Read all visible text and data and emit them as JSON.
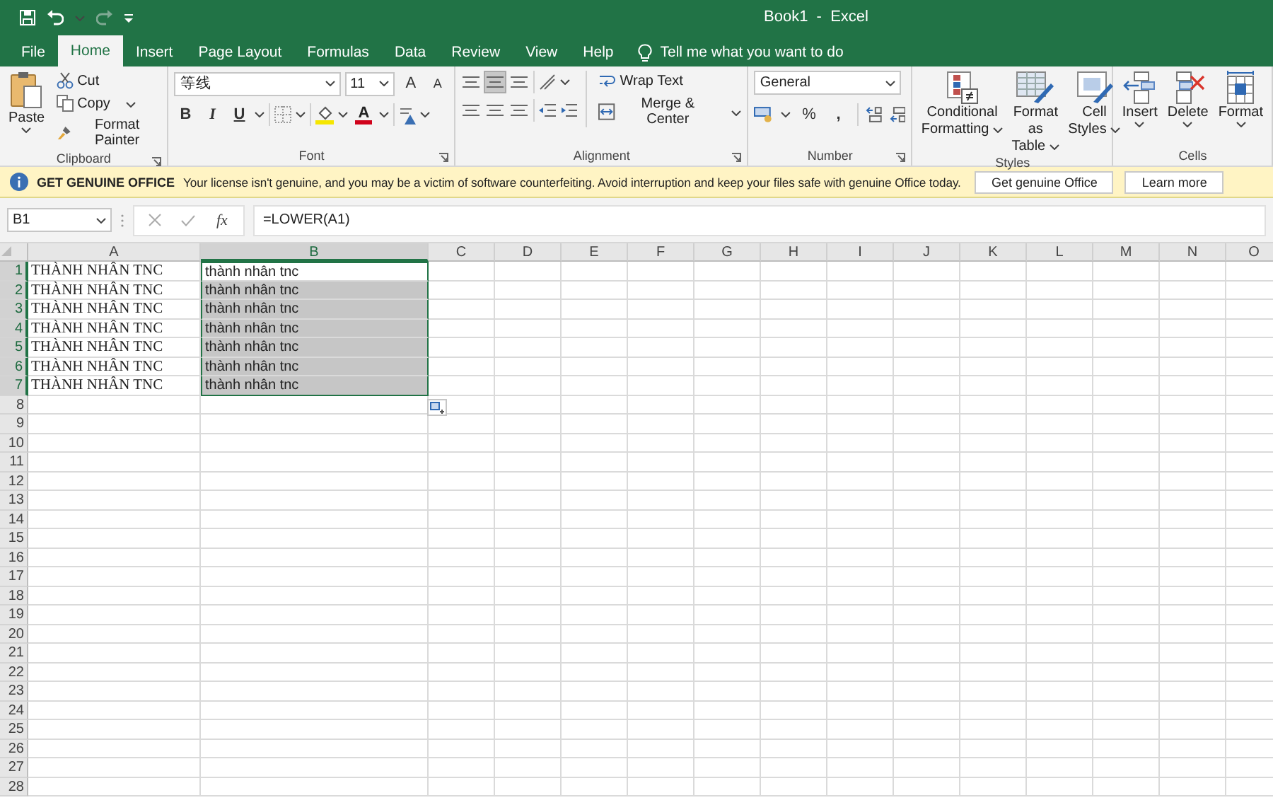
{
  "title_bar": {
    "title": "Book1  -  Excel"
  },
  "tabs": [
    {
      "label": "File",
      "selected": false
    },
    {
      "label": "Home",
      "selected": true
    },
    {
      "label": "Insert",
      "selected": false
    },
    {
      "label": "Page Layout",
      "selected": false
    },
    {
      "label": "Formulas",
      "selected": false
    },
    {
      "label": "Data",
      "selected": false
    },
    {
      "label": "Review",
      "selected": false
    },
    {
      "label": "View",
      "selected": false
    },
    {
      "label": "Help",
      "selected": false
    }
  ],
  "tell_me": {
    "placeholder": "Tell me what you want to do"
  },
  "ribbon": {
    "clipboard": {
      "label": "Clipboard",
      "paste": "Paste",
      "cut": "Cut",
      "copy": "Copy",
      "format_painter": "Format Painter"
    },
    "font": {
      "label": "Font",
      "font_name": "等线",
      "font_size": "11",
      "grow": "A",
      "shrink": "A",
      "bold": "B",
      "italic": "I",
      "underline": "U",
      "font_color": "A"
    },
    "alignment": {
      "label": "Alignment",
      "vertical_align": [
        {
          "selected": false
        },
        {
          "selected": true
        },
        {
          "selected": false
        }
      ],
      "wrap_text": "Wrap Text",
      "merge_center": "Merge & Center"
    },
    "number": {
      "label": "Number",
      "format": "General",
      "percent": "%",
      "comma": ","
    },
    "styles": {
      "label": "Styles",
      "buttons": [
        {
          "kind": "conditional",
          "lines": [
            "Conditional",
            "Formatting"
          ]
        },
        {
          "kind": "table",
          "lines": [
            "Format as",
            "Table"
          ]
        },
        {
          "kind": "cell_styles",
          "lines": [
            "Cell",
            "Styles"
          ]
        }
      ]
    },
    "cells": {
      "label": "Cells",
      "buttons": [
        {
          "kind": "insert",
          "label": "Insert"
        },
        {
          "kind": "delete",
          "label": "Delete"
        },
        {
          "kind": "format",
          "label": "Format"
        }
      ]
    }
  },
  "message_bar": {
    "title": "GET GENUINE OFFICE",
    "text": "Your license isn't genuine, and you may be a victim of software counterfeiting. Avoid interruption and keep your files safe with genuine Office today.",
    "buttons": [
      "Get genuine Office",
      "Learn more"
    ]
  },
  "formula_bar": {
    "name_box": "B1",
    "function_label": "fx",
    "formula": "=LOWER(A1)"
  },
  "sheet": {
    "columns": [
      {
        "label": "A",
        "selected": false
      },
      {
        "label": "B",
        "selected": true
      },
      {
        "label": "C",
        "selected": false
      },
      {
        "label": "D",
        "selected": false
      },
      {
        "label": "E",
        "selected": false
      },
      {
        "label": "F",
        "selected": false
      },
      {
        "label": "G",
        "selected": false
      },
      {
        "label": "H",
        "selected": false
      },
      {
        "label": "I",
        "selected": false
      },
      {
        "label": "J",
        "selected": false
      },
      {
        "label": "K",
        "selected": false
      },
      {
        "label": "L",
        "selected": false
      },
      {
        "label": "M",
        "selected": false
      },
      {
        "label": "N",
        "selected": false
      },
      {
        "label": "O",
        "selected": false
      }
    ],
    "rows": [
      {
        "label": "1",
        "selected": true,
        "cells": [
          {
            "text": "THÀNH NHÂN TNC",
            "selected": false,
            "active": false
          },
          {
            "text": "thành nhân tnc",
            "selected": false,
            "active": true
          }
        ]
      },
      {
        "label": "2",
        "selected": true,
        "cells": [
          {
            "text": "THÀNH NHÂN TNC",
            "selected": false,
            "active": false
          },
          {
            "text": "thành nhân tnc",
            "selected": true,
            "active": false
          }
        ]
      },
      {
        "label": "3",
        "selected": true,
        "cells": [
          {
            "text": "THÀNH NHÂN TNC",
            "selected": false,
            "active": false
          },
          {
            "text": "thành nhân tnc",
            "selected": true,
            "active": false
          }
        ]
      },
      {
        "label": "4",
        "selected": true,
        "cells": [
          {
            "text": "THÀNH NHÂN TNC",
            "selected": false,
            "active": false
          },
          {
            "text": "thành nhân tnc",
            "selected": true,
            "active": false
          }
        ]
      },
      {
        "label": "5",
        "selected": true,
        "cells": [
          {
            "text": "THÀNH NHÂN TNC",
            "selected": false,
            "active": false
          },
          {
            "text": "thành nhân tnc",
            "selected": true,
            "active": false
          }
        ]
      },
      {
        "label": "6",
        "selected": true,
        "cells": [
          {
            "text": "THÀNH NHÂN TNC",
            "selected": false,
            "active": false
          },
          {
            "text": "thành nhân tnc",
            "selected": true,
            "active": false
          }
        ]
      },
      {
        "label": "7",
        "selected": true,
        "cells": [
          {
            "text": "THÀNH NHÂN TNC",
            "selected": false,
            "active": false
          },
          {
            "text": "thành nhân tnc",
            "selected": true,
            "active": false
          }
        ]
      },
      {
        "label": "8",
        "selected": false
      },
      {
        "label": "9",
        "selected": false
      },
      {
        "label": "10",
        "selected": false
      },
      {
        "label": "11",
        "selected": false
      },
      {
        "label": "12",
        "selected": false
      },
      {
        "label": "13",
        "selected": false
      },
      {
        "label": "14",
        "selected": false
      },
      {
        "label": "15",
        "selected": false
      },
      {
        "label": "16",
        "selected": false
      },
      {
        "label": "17",
        "selected": false
      },
      {
        "label": "18",
        "selected": false
      },
      {
        "label": "19",
        "selected": false
      },
      {
        "label": "20",
        "selected": false
      },
      {
        "label": "21",
        "selected": false
      },
      {
        "label": "22",
        "selected": false
      },
      {
        "label": "23",
        "selected": false
      },
      {
        "label": "24",
        "selected": false
      },
      {
        "label": "25",
        "selected": false
      },
      {
        "label": "26",
        "selected": false
      },
      {
        "label": "27",
        "selected": false
      },
      {
        "label": "28",
        "selected": false
      }
    ]
  }
}
